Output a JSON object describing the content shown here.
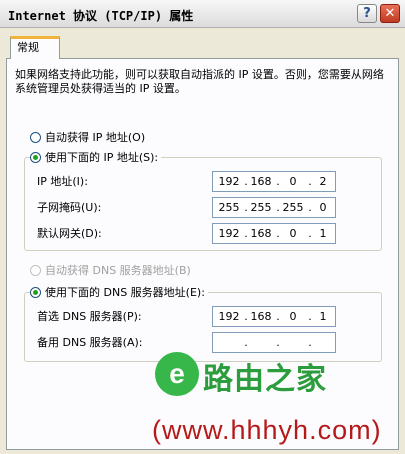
{
  "window": {
    "title": "Internet 协议 (TCP/IP) 属性",
    "help_label": "?",
    "close_label": "✕"
  },
  "tabs": [
    {
      "label": "常规"
    }
  ],
  "description": "如果网络支持此功能，则可以获取自动指派的 IP 设置。否则，您需要从网络系统管理员处获得适当的 IP 设置。",
  "ip": {
    "auto_option": "自动获得 IP 地址(O)",
    "manual_option": "使用下面的 IP 地址(S):",
    "selected": "manual",
    "fields": [
      {
        "label": "IP 地址(I):",
        "octets": [
          "192",
          "168",
          "0",
          "2"
        ]
      },
      {
        "label": "子网掩码(U):",
        "octets": [
          "255",
          "255",
          "255",
          "0"
        ]
      },
      {
        "label": "默认网关(D):",
        "octets": [
          "192",
          "168",
          "0",
          "1"
        ]
      }
    ]
  },
  "dns": {
    "auto_option": "自动获得 DNS 服务器地址(B)",
    "auto_enabled": false,
    "manual_option": "使用下面的 DNS 服务器地址(E):",
    "selected": "manual",
    "fields": [
      {
        "label": "首选 DNS 服务器(P):",
        "octets": [
          "192",
          "168",
          "0",
          "1"
        ]
      },
      {
        "label": "备用 DNS 服务器(A):",
        "octets": [
          "",
          "",
          "",
          ""
        ]
      }
    ]
  },
  "watermark": {
    "logo_glyph": "e",
    "name": "路由之家",
    "url": "(www.hhhyh.com)"
  }
}
